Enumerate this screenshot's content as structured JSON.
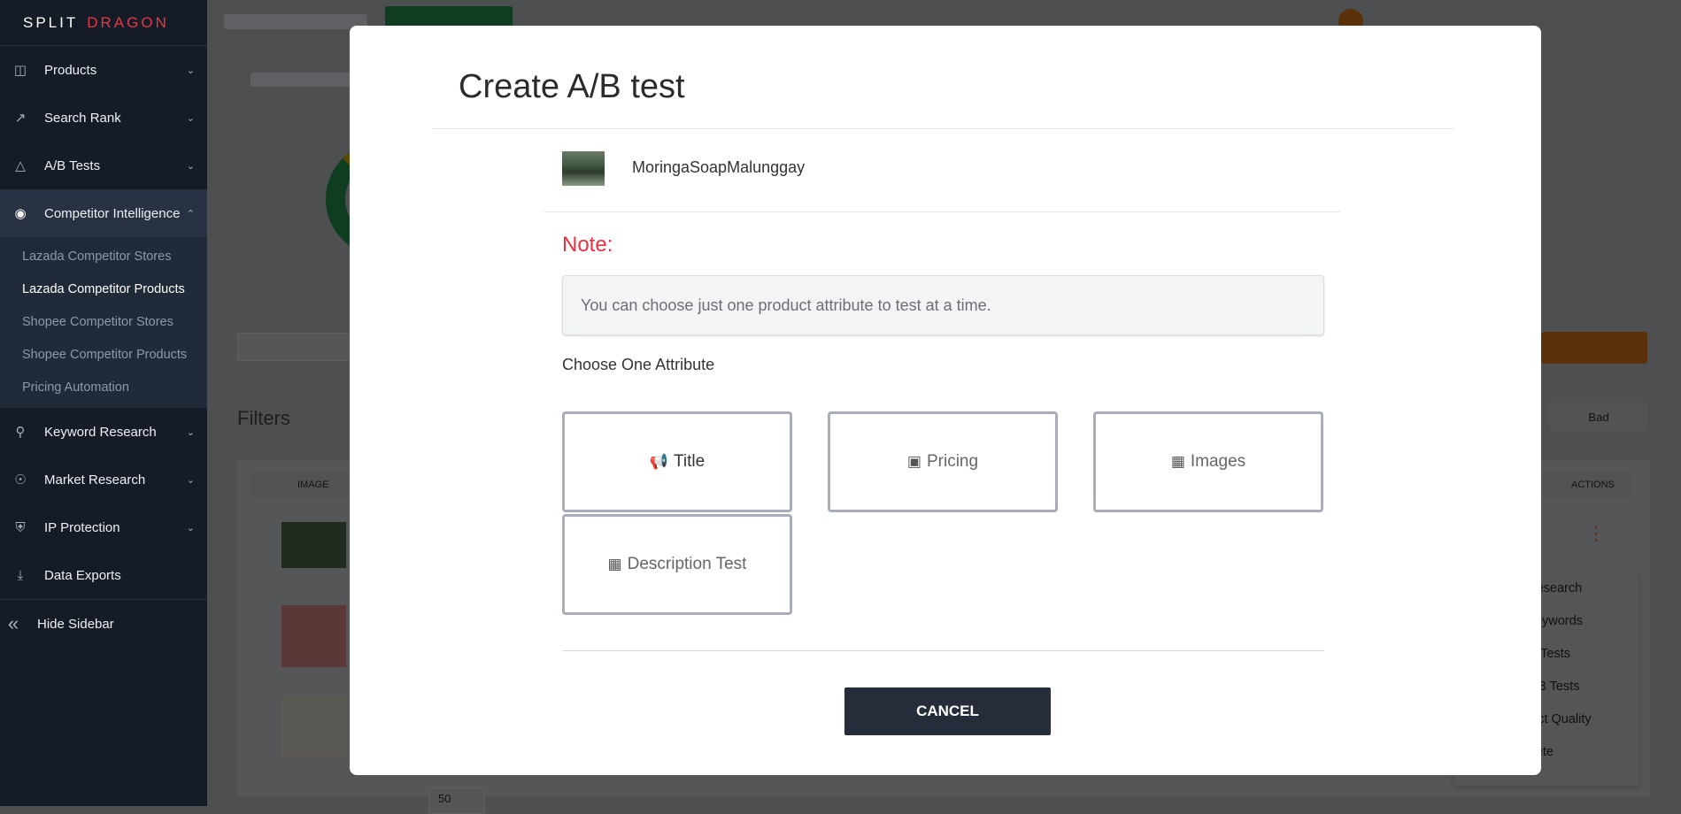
{
  "sidebar": {
    "logo": {
      "part1": "SPLIT",
      "part2": "DRAGON"
    },
    "items": [
      {
        "label": "Products",
        "icon": "shopping-bag-icon"
      },
      {
        "label": "Search Rank",
        "icon": "chart-line-icon"
      },
      {
        "label": "A/B Tests",
        "icon": "flask-icon"
      },
      {
        "label": "Competitor Intelligence",
        "icon": "eye-icon"
      },
      {
        "label": "Keyword Research",
        "icon": "search-icon"
      },
      {
        "label": "Market Research",
        "icon": "globe-icon"
      },
      {
        "label": "IP Protection",
        "icon": "shield-icon"
      },
      {
        "label": "Data Exports",
        "icon": "download-icon"
      },
      {
        "label": "Hide Sidebar",
        "icon": "double-chevron-left-icon"
      }
    ],
    "subitems": [
      "Lazada Competitor Stores",
      "Lazada Competitor Products",
      "Shopee Competitor Stores",
      "Shopee Competitor Products",
      "Pricing Automation"
    ],
    "current_subitem": "Lazada Competitor Products"
  },
  "background": {
    "filters_label": "Filters",
    "bad_button": "Bad",
    "table_headers": {
      "image": "IMAGE",
      "actions": "ACTIONS"
    },
    "action_menu": [
      "d Research",
      "v Keywords",
      "A/B Tests",
      "v A/B Tests",
      "oduct Quality",
      "Delete"
    ],
    "per_page": "50"
  },
  "modal": {
    "title": "Create A/B test",
    "product_name": "MoringaSoapMalunggay",
    "note_label": "Note:",
    "note_text": "You can choose just one product attribute to test at a time.",
    "choose_label": "Choose One Attribute",
    "attributes": [
      {
        "label": "Title",
        "icon": "bullhorn-icon"
      },
      {
        "label": "Pricing",
        "icon": "money-bill-icon"
      },
      {
        "label": "Images",
        "icon": "image-icon"
      },
      {
        "label": "Description Test",
        "icon": "image-icon"
      }
    ],
    "cancel_label": "CANCEL"
  },
  "colors": {
    "accent_red": "#e8313f",
    "sidebar_bg": "#151c27",
    "cancel_bg": "#272c3a",
    "brand_orange": "#e07b12",
    "brand_green": "#1e9e4a"
  }
}
